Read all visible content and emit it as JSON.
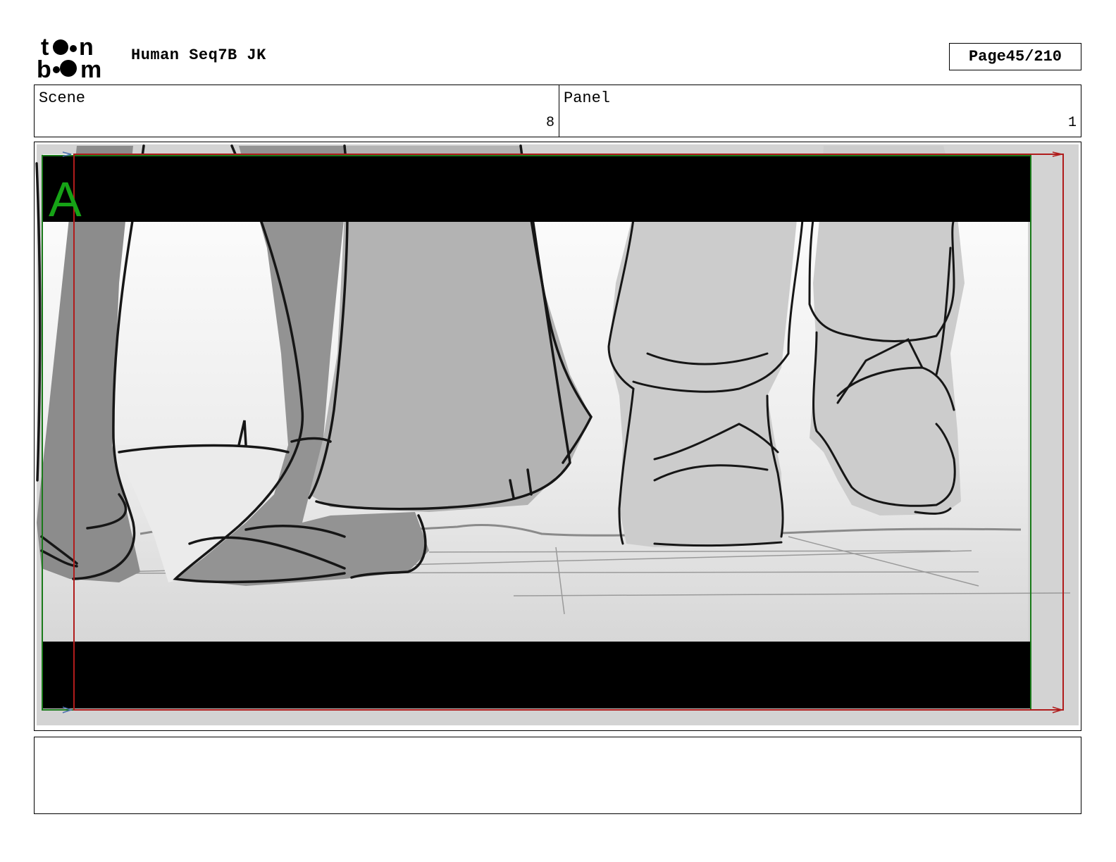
{
  "header": {
    "logo_text": "toon boom",
    "title": "Human Seq7B JK",
    "page_label": "Page",
    "page_number": "45/210"
  },
  "info": {
    "scene_label": "Scene",
    "scene_value": "8",
    "panel_label": "Panel",
    "panel_value": "1"
  },
  "panel": {
    "layer_label": "A",
    "layer_label_color": "#16a316",
    "safe_frame_color": "#1a7a1a",
    "camera_frame_color": "#b01c1c"
  },
  "notes": {
    "text": ""
  }
}
